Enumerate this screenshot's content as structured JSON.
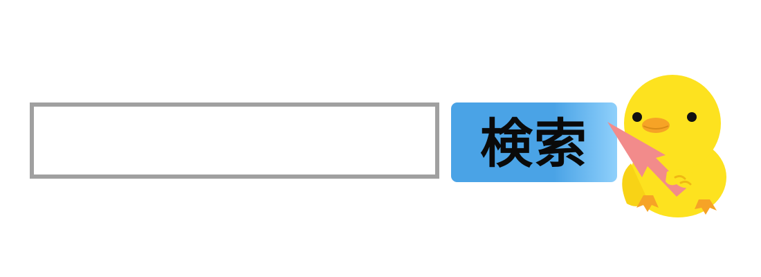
{
  "search": {
    "value": "",
    "placeholder": ""
  },
  "search_button": {
    "label": "検索"
  },
  "colors": {
    "input_border": "#a0a0a0",
    "button_start": "#4aa3e6",
    "button_end": "#8fd0fb",
    "cursor": "#f28b8b",
    "chick_body": "#fde21f",
    "chick_beak": "#f6a326"
  },
  "icons": {
    "cursor": "arrow-cursor-icon",
    "mascot": "chick-mascot-illustration"
  }
}
